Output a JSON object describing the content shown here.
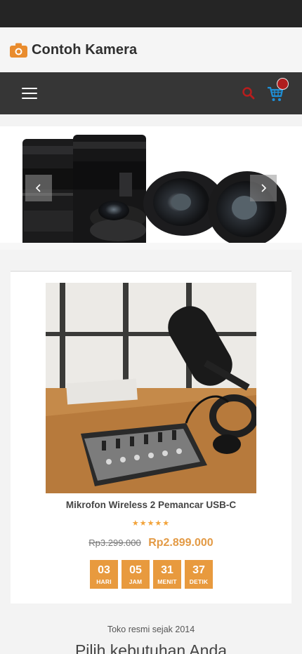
{
  "header": {
    "logo_icon": "camera-icon",
    "brand_name": "Contoh Kamera",
    "accent_color": "#e98c2e"
  },
  "navbar": {
    "menu_icon": "hamburger-menu-icon",
    "search_icon": "search-icon",
    "cart_icon": "shopping-cart-icon",
    "search_color": "#b81d1d",
    "cart_color": "#1e90d8"
  },
  "slider": {
    "prev_icon": "chevron-left-icon",
    "next_icon": "chevron-right-icon"
  },
  "product": {
    "name": "Mikrofon Wireless 2 Pemancar USB-C",
    "rating": 5,
    "old_price": "Rp3.299.000",
    "new_price": "Rp2.899.000",
    "countdown": [
      {
        "value": "03",
        "label": "HARI"
      },
      {
        "value": "05",
        "label": "JAM"
      },
      {
        "value": "31",
        "label": "MENIT"
      },
      {
        "value": "37",
        "label": "DETIK"
      }
    ]
  },
  "section": {
    "tagline": "Toko resmi sejak 2014",
    "title": "Pilih kebutuhan Anda"
  }
}
